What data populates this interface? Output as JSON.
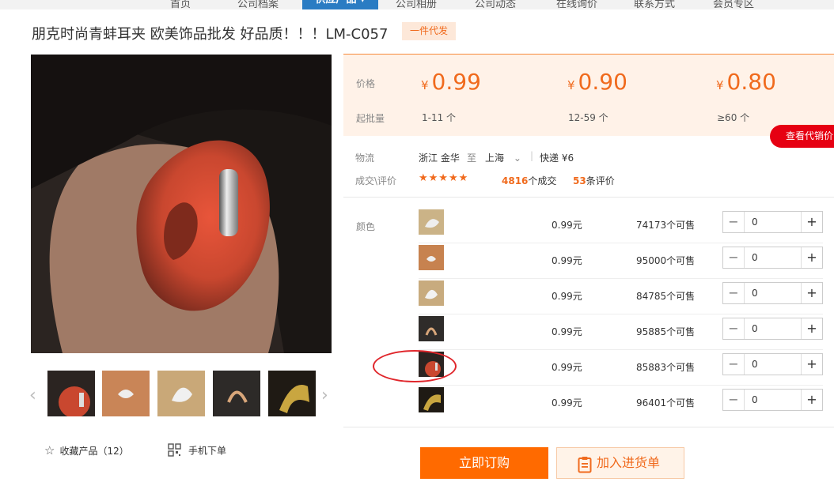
{
  "nav": {
    "items": [
      "首页",
      "公司档案",
      "供应产品",
      "公司相册",
      "公司动态",
      "在线询价",
      "联系方式",
      "会员专区"
    ],
    "active_label": "供应产品 ▾"
  },
  "product": {
    "title": "朋克时尚青蚌耳夹 欧美饰品批发 好品质！！！LM-C057",
    "badge": "一件代发"
  },
  "pricing": {
    "price_label": "价格",
    "qty_label": "起批量",
    "currency": "¥",
    "tiers": [
      {
        "price": "0.99",
        "qty": "1-11 个"
      },
      {
        "price": "0.90",
        "qty": "12-59 个"
      },
      {
        "price": "0.80",
        "qty": "≥60 个"
      }
    ]
  },
  "agent_price_button": "查看代销价",
  "logistics": {
    "label": "物流",
    "from": "浙江 金华",
    "to_word": "至",
    "to": "上海",
    "shipping": "快递 ¥6"
  },
  "deals": {
    "label": "成交\\评价",
    "stars": "★★★★★",
    "deal_count": "4816",
    "deal_suffix": "个成交",
    "review_count": "53",
    "review_suffix": "条评价"
  },
  "sku": {
    "label": "颜色",
    "rows": [
      {
        "price": "0.99元",
        "stock": "74173个可售",
        "qty": "0"
      },
      {
        "price": "0.99元",
        "stock": "95000个可售",
        "qty": "0"
      },
      {
        "price": "0.99元",
        "stock": "84785个可售",
        "qty": "0"
      },
      {
        "price": "0.99元",
        "stock": "95885个可售",
        "qty": "0"
      },
      {
        "price": "0.99元",
        "stock": "85883个可售",
        "qty": "0"
      },
      {
        "price": "0.99元",
        "stock": "96401个可售",
        "qty": "0"
      }
    ]
  },
  "actions": {
    "favorite": "收藏产品（12）",
    "mobile_order": "手机下单",
    "buy_now": "立即订购",
    "add_to_cart": "加入进货单"
  },
  "colors": {
    "accent": "#f06a1d",
    "buy_button": "#ff6a00",
    "agent_button": "#e60012",
    "price_bg": "#fff2e8"
  }
}
